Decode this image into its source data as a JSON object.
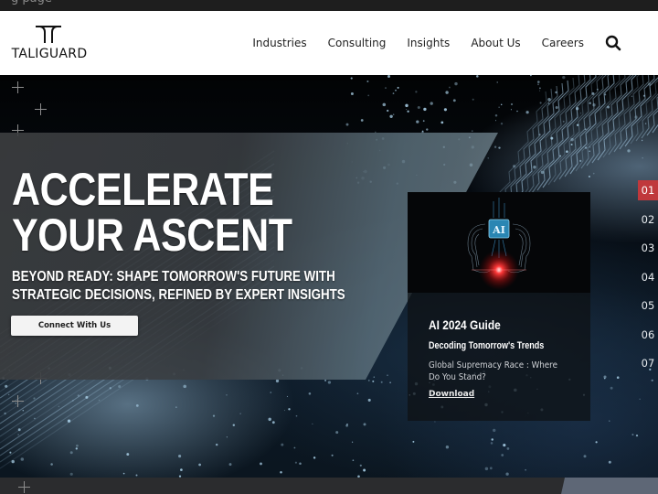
{
  "browser": {
    "partial_text": "g page"
  },
  "header": {
    "logo_text": "TALIGUARD",
    "nav": [
      {
        "label": "Industries"
      },
      {
        "label": "Consulting"
      },
      {
        "label": "Insights"
      },
      {
        "label": "About Us"
      },
      {
        "label": "Careers"
      }
    ],
    "search_icon": "search-icon"
  },
  "hero": {
    "title_line1": "ACCELERATE",
    "title_line2": "YOUR ASCENT",
    "subtitle_line1": "BEYOND READY: SHAPE TOMORROW'S FUTURE WITH",
    "subtitle_line2": "STRATEGIC DECISIONS, REFINED BY EXPERT INSIGHTS",
    "cta_label": "Connect With Us"
  },
  "card": {
    "image_badge": "AI",
    "title": "AI 2024 Guide",
    "subtitle": "Decoding Tomorrow's Trends",
    "description": "Global Supremacy Race : Where Do You Stand?",
    "link_label": "Download"
  },
  "pager": {
    "active_index": 0,
    "items": [
      "01",
      "02",
      "03",
      "04",
      "05",
      "06",
      "07"
    ]
  },
  "colors": {
    "accent_red": "#c0383c",
    "nav_bg": "#ffffff",
    "hero_panel": "#3c3e40",
    "footer_strip": "#2b2c2e",
    "footer_accent": "#5e6776"
  }
}
